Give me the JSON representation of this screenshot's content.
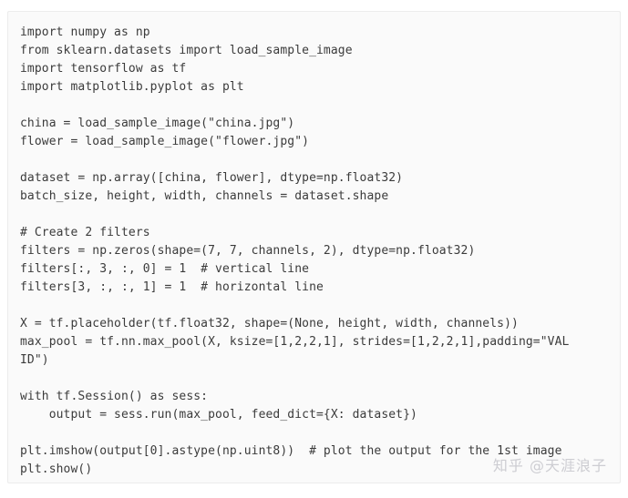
{
  "code_block": {
    "language": "python",
    "lines": [
      "import numpy as np",
      "from sklearn.datasets import load_sample_image",
      "import tensorflow as tf",
      "import matplotlib.pyplot as plt",
      "",
      "china = load_sample_image(\"china.jpg\")",
      "flower = load_sample_image(\"flower.jpg\")",
      "",
      "dataset = np.array([china, flower], dtype=np.float32)",
      "batch_size, height, width, channels = dataset.shape",
      "",
      "# Create 2 filters",
      "filters = np.zeros(shape=(7, 7, channels, 2), dtype=np.float32)",
      "filters[:, 3, :, 0] = 1  # vertical line",
      "filters[3, :, :, 1] = 1  # horizontal line",
      "",
      "X = tf.placeholder(tf.float32, shape=(None, height, width, channels))",
      "max_pool = tf.nn.max_pool(X, ksize=[1,2,2,1], strides=[1,2,2,1],padding=\"VAL",
      "ID\")",
      "",
      "with tf.Session() as sess:",
      "    output = sess.run(max_pool, feed_dict={X: dataset})",
      "",
      "plt.imshow(output[0].astype(np.uint8))  # plot the output for the 1st image",
      "plt.show()"
    ]
  },
  "watermark": {
    "text": "知乎 @天涯浪子"
  },
  "colors": {
    "code_background": "#fafafa",
    "code_border": "#ececec",
    "code_text": "#3b3b3b",
    "watermark_text": "#cdcdd2",
    "page_background": "#ffffff"
  }
}
